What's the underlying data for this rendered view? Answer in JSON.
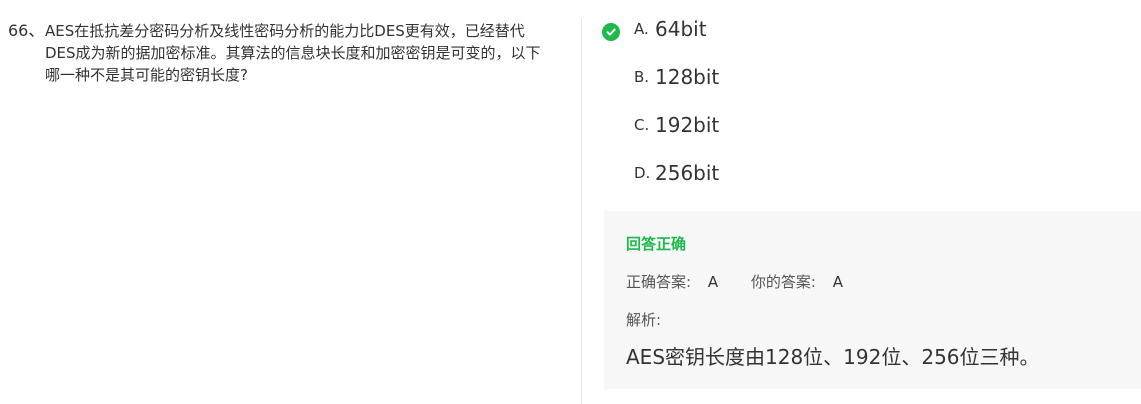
{
  "question": {
    "number": "66、",
    "text": "AES在抵抗差分密码分析及线性密码分析的能力比DES更有效，已经替代DES成为新的据加密标准。其算法的信息块长度和加密密钥是可变的，以下哪一种不是其可能的密钥长度?"
  },
  "options": [
    {
      "letter": "A.",
      "text": "64bit",
      "selected": true
    },
    {
      "letter": "B.",
      "text": "128bit",
      "selected": false
    },
    {
      "letter": "C.",
      "text": "192bit",
      "selected": false
    },
    {
      "letter": "D.",
      "text": "256bit",
      "selected": false
    }
  ],
  "answer": {
    "result": "回答正确",
    "correct_label": "正确答案:",
    "correct_value": "A",
    "yours_label": "你的答案:",
    "yours_value": "A",
    "explain_label": "解析:",
    "explain_text": "AES密钥长度由128位、192位、256位三种。"
  },
  "colors": {
    "correct": "#1fb94e",
    "panel_bg": "#f7f7f7",
    "text": "#333333"
  },
  "icons": {
    "selected_option": "check-circle-icon"
  }
}
